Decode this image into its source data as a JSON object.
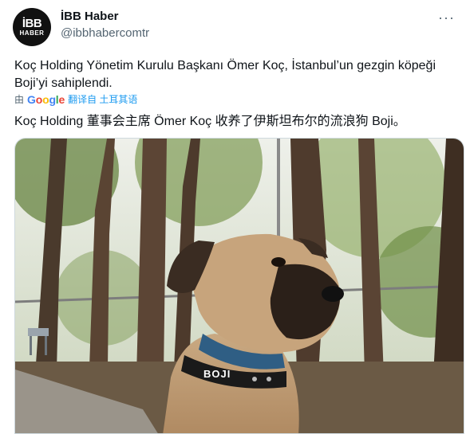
{
  "author": {
    "avatar_line1": "İBB",
    "avatar_line2": "HABER",
    "display_name": "İBB Haber",
    "handle": "@ibbhabercomtr"
  },
  "tweet": {
    "text": "Koç Holding Yönetim Kurulu Başkanı Ömer Koç, İstanbul’un gezgin köpeği Boji’yi sahiplendi."
  },
  "translation": {
    "by_label": "由",
    "provider": "Google",
    "link_text": "翻译自 土耳其语",
    "text": "Koç Holding 董事会主席 Ömer Koç 收养了伊斯坦布尔的流浪狗 Boji。"
  },
  "media": {
    "collar_text": "BOJI"
  }
}
